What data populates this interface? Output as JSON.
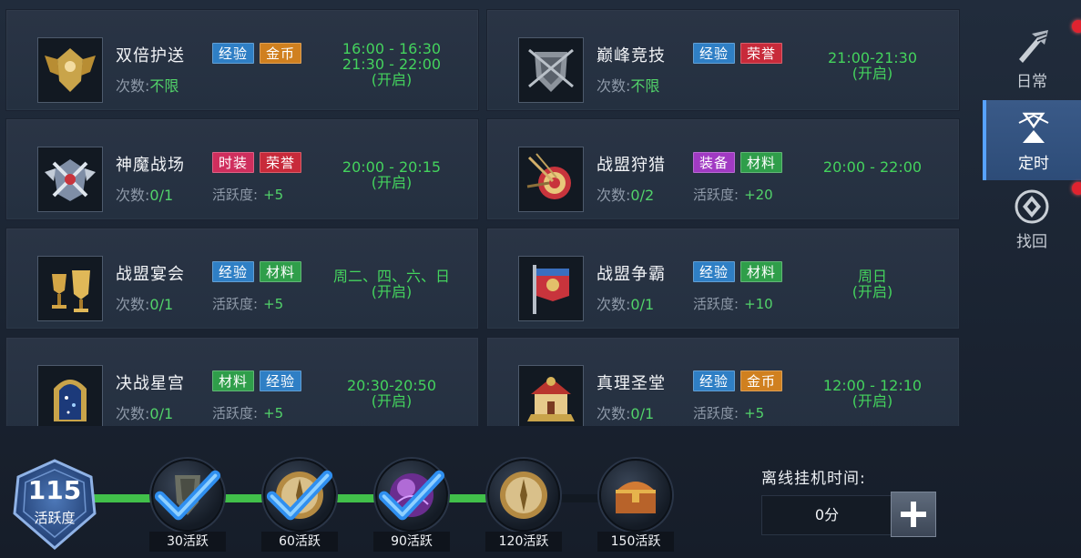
{
  "activities": [
    {
      "name": "双倍护送",
      "tags": [
        {
          "text": "经验",
          "color": "blue"
        },
        {
          "text": "金币",
          "color": "gold"
        }
      ],
      "count_label": "次数:",
      "count_value": "不限",
      "active_label": "",
      "active_value": "",
      "time_lines": [
        "16:00 - 16:30",
        "21:30 - 22:00"
      ],
      "time_status": "(开启)",
      "icon": "winged-shield-emblem-icon"
    },
    {
      "name": "巅峰竞技",
      "tags": [
        {
          "text": "经验",
          "color": "blue"
        },
        {
          "text": "荣誉",
          "color": "red"
        }
      ],
      "count_label": "次数:",
      "count_value": "不限",
      "active_label": "",
      "active_value": "",
      "time_lines": [
        "21:00-21:30"
      ],
      "time_status": "(开启)",
      "icon": "armor-shield-icon"
    },
    {
      "name": "神魔战场",
      "tags": [
        {
          "text": "时装",
          "color": "pink"
        },
        {
          "text": "荣誉",
          "color": "red"
        }
      ],
      "count_label": "次数:",
      "count_value": "0/1",
      "active_label": "活跃度:",
      "active_value": "+5",
      "time_lines": [
        "20:00 - 20:15"
      ],
      "time_status": "(开启)",
      "icon": "crossed-swords-wings-icon"
    },
    {
      "name": "战盟狩猎",
      "tags": [
        {
          "text": "装备",
          "color": "purple"
        },
        {
          "text": "材料",
          "color": "green"
        }
      ],
      "count_label": "次数:",
      "count_value": "0/2",
      "active_label": "活跃度:",
      "active_value": "+20",
      "time_lines": [
        "20:00 - 22:00"
      ],
      "time_status": "",
      "icon": "target-arrows-icon"
    },
    {
      "name": "战盟宴会",
      "tags": [
        {
          "text": "经验",
          "color": "blue"
        },
        {
          "text": "材料",
          "color": "green"
        }
      ],
      "count_label": "次数:",
      "count_value": "0/1",
      "active_label": "活跃度:",
      "active_value": "+5",
      "time_lines": [
        "周二、四、六、日"
      ],
      "time_status": "(开启)",
      "icon": "golden-goblets-icon"
    },
    {
      "name": "战盟争霸",
      "tags": [
        {
          "text": "经验",
          "color": "blue"
        },
        {
          "text": "材料",
          "color": "green"
        }
      ],
      "count_label": "次数:",
      "count_value": "0/1",
      "active_label": "活跃度:",
      "active_value": "+10",
      "time_lines": [
        "周日"
      ],
      "time_status": "(开启)",
      "icon": "war-banner-icon"
    },
    {
      "name": "决战星宫",
      "tags": [
        {
          "text": "材料",
          "color": "green"
        },
        {
          "text": "经验",
          "color": "blue"
        }
      ],
      "count_label": "次数:",
      "count_value": "0/1",
      "active_label": "活跃度:",
      "active_value": "+5",
      "time_lines": [
        "20:30-20:50"
      ],
      "time_status": "(开启)",
      "icon": "star-gate-icon"
    },
    {
      "name": "真理圣堂",
      "tags": [
        {
          "text": "经验",
          "color": "blue"
        },
        {
          "text": "金币",
          "color": "gold"
        }
      ],
      "count_label": "次数:",
      "count_value": "0/1",
      "active_label": "活跃度:",
      "active_value": "+5",
      "time_lines": [
        "12:00 - 12:10"
      ],
      "time_status": "(开启)",
      "icon": "temple-icon"
    }
  ],
  "tabs": [
    {
      "label": "日常",
      "icon": "sword-wing-icon",
      "selected": false,
      "dot": true
    },
    {
      "label": "定时",
      "icon": "hourglass-icon",
      "selected": true,
      "dot": true
    },
    {
      "label": "找回",
      "icon": "recover-diamond-icon",
      "selected": false,
      "dot": false
    }
  ],
  "progress": {
    "current": "115",
    "current_label": "活跃度",
    "fill_fraction": 0.75,
    "milestones": [
      {
        "label": "30活跃",
        "claimed": true,
        "icon": "shield-reward-icon"
      },
      {
        "label": "60活跃",
        "claimed": true,
        "icon": "compass-reward-icon"
      },
      {
        "label": "90活跃",
        "claimed": true,
        "icon": "purple-orb-reward-icon"
      },
      {
        "label": "120活跃",
        "claimed": false,
        "icon": "compass-reward-icon"
      },
      {
        "label": "150活跃",
        "claimed": false,
        "icon": "treasure-chest-icon"
      }
    ]
  },
  "offline": {
    "label": "离线挂机时间:",
    "value": "0分"
  },
  "colors": {
    "time_green": "#44d35d",
    "value_green": "#52d36a",
    "tab_selected": "#2d4c78",
    "progress_fill": "#41c04a"
  }
}
